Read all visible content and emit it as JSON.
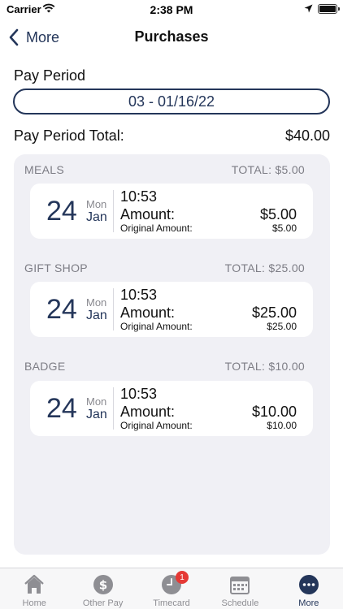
{
  "status_bar": {
    "carrier": "Carrier",
    "time": "2:38 PM"
  },
  "nav": {
    "back_label": "More",
    "title": "Purchases"
  },
  "pay_period": {
    "label": "Pay Period",
    "value": "03 - 01/16/22"
  },
  "total": {
    "label": "Pay Period Total:",
    "value": "$40.00"
  },
  "categories": [
    {
      "name": "MEALS",
      "total": "TOTAL: $5.00",
      "purchase": {
        "day": "24",
        "dow": "Mon",
        "month": "Jan",
        "time": "10:53",
        "amount_label": "Amount:",
        "amount": "$5.00",
        "orig_label": "Original Amount:",
        "orig_amount": "$5.00"
      }
    },
    {
      "name": "GIFT SHOP",
      "total": "TOTAL: $25.00",
      "purchase": {
        "day": "24",
        "dow": "Mon",
        "month": "Jan",
        "time": "10:53",
        "amount_label": "Amount:",
        "amount": "$25.00",
        "orig_label": "Original Amount:",
        "orig_amount": "$25.00"
      }
    },
    {
      "name": "BADGE",
      "total": "TOTAL: $10.00",
      "purchase": {
        "day": "24",
        "dow": "Mon",
        "month": "Jan",
        "time": "10:53",
        "amount_label": "Amount:",
        "amount": "$10.00",
        "orig_label": "Original Amount:",
        "orig_amount": "$10.00"
      }
    }
  ],
  "tabs": [
    {
      "label": "Home",
      "icon": "home-icon",
      "active": false
    },
    {
      "label": "Other Pay",
      "icon": "dollar-icon",
      "active": false
    },
    {
      "label": "Timecard",
      "icon": "clock-icon",
      "active": false,
      "badge": "1"
    },
    {
      "label": "Schedule",
      "icon": "calendar-icon",
      "active": false
    },
    {
      "label": "More",
      "icon": "more-icon",
      "active": true
    }
  ],
  "colors": {
    "accent": "#24365a",
    "panel": "#f0f0f5",
    "muted": "#7d7d85",
    "badge": "#e53935"
  }
}
